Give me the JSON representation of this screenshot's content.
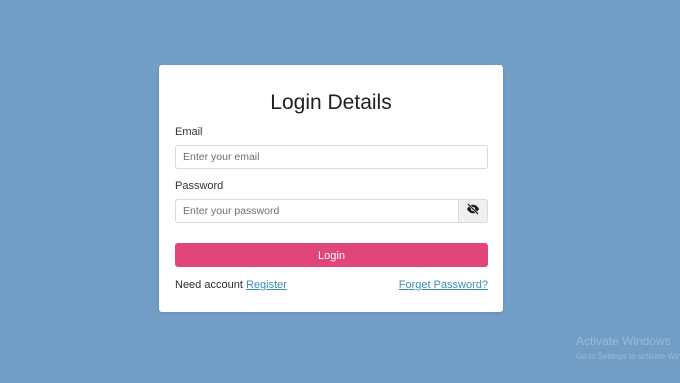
{
  "login": {
    "title": "Login Details",
    "email_label": "Email",
    "email_placeholder": "Enter your email",
    "email_value": "",
    "password_label": "Password",
    "password_placeholder": "Enter your password",
    "password_value": "",
    "toggle_icon": "eye-slash-icon",
    "login_button": "Login",
    "need_account_text": "Need account",
    "register_link": "Register",
    "forgot_link": "Forget Password?"
  },
  "colors": {
    "background": "#729ec5",
    "card": "#ffffff",
    "accent": "#e0457c",
    "link": "#3a8fb7"
  },
  "watermark": {
    "title": "Activate Windows",
    "subtitle": "Go to Settings to activate Windows."
  }
}
